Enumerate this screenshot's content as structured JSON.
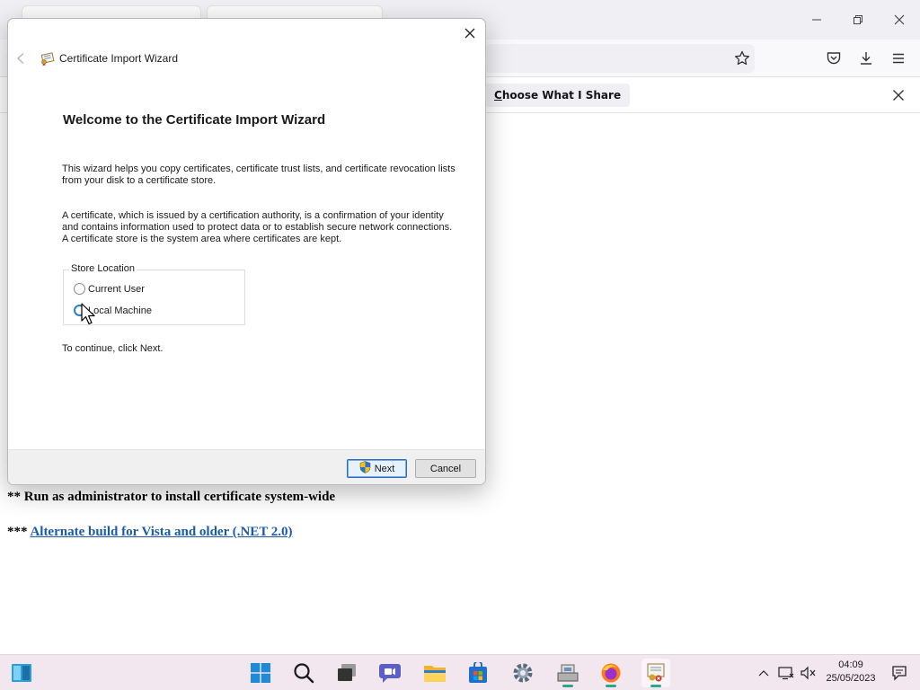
{
  "browser": {
    "share_button_prefix": "C",
    "share_button_rest": "hoose What I Share",
    "page_line1": "** Run as administrator to install certificate system-wide",
    "page_line2_prefix": "*** ",
    "page_line2_link": "Alternate build for Vista and older (.NET 2.0)"
  },
  "dialog": {
    "title": "Certificate Import Wizard",
    "heading": "Welcome to the Certificate Import Wizard",
    "para1": "This wizard helps you copy certificates, certificate trust lists, and certificate revocation lists from your disk to a certificate store.",
    "para2": "A certificate, which is issued by a certification authority, is a confirmation of your identity and contains information used to protect data or to establish secure network connections. A certificate store is the system area where certificates are kept.",
    "store_location": {
      "legend": "Store Location",
      "options": [
        {
          "label": "Current User",
          "selected": false
        },
        {
          "label": "Local Machine",
          "selected": false
        }
      ]
    },
    "continue_text": "To continue, click Next.",
    "next_label": "Next",
    "cancel_label": "Cancel"
  },
  "taskbar": {
    "time": "04:09",
    "date": "25/05/2023"
  },
  "colors": {
    "link": "#1a5aa8",
    "accent": "#2b6bc6",
    "taskbar_bg": "#f3e7ef"
  }
}
